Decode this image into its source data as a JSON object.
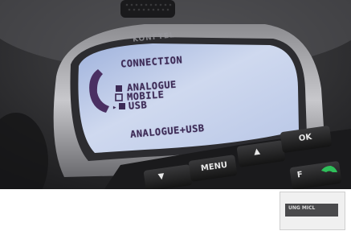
{
  "photo": {
    "brand": "KONFTEL",
    "lcd": {
      "title": "CONNECTION",
      "options": [
        "ANALOGUE",
        "MOBILE",
        "USB"
      ],
      "selected_marker": "▸",
      "selected_value": "ANALOGUE+USB"
    },
    "keys": {
      "menu": "MENU",
      "ok": "OK",
      "up": "▲",
      "down": "▼",
      "f": "F"
    }
  },
  "thumbnail": {
    "label": "UNG MICL"
  }
}
